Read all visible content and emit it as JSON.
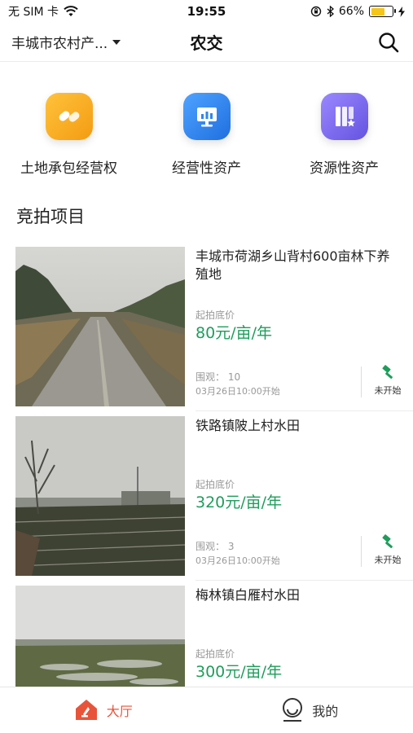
{
  "status_bar": {
    "carrier": "无 SIM 卡",
    "time": "19:55",
    "battery": "66%",
    "battery_level": 0.66
  },
  "nav": {
    "location": "丰城市农村产...",
    "title": "农交"
  },
  "categories": [
    {
      "label": "土地承包经营权",
      "icon": "handshake-icon",
      "color": "#f7a623"
    },
    {
      "label": "经营性资产",
      "icon": "monitor-chart-icon",
      "color": "#2f86f0"
    },
    {
      "label": "资源性资产",
      "icon": "book-star-icon",
      "color": "#7765e8"
    }
  ],
  "section": {
    "title": "竞拍项目"
  },
  "auction_items": [
    {
      "title": "丰城市荷湖乡山背村600亩林下养殖地",
      "price_label": "起拍底价",
      "price": "80元/亩/年",
      "views": "围观：  10",
      "start_time": "03月26日10:00开始",
      "status": "未开始",
      "photo": "rural-road"
    },
    {
      "title": "铁路镇陂上村水田",
      "price_label": "起拍底价",
      "price": "320元/亩/年",
      "views": "围观：  3",
      "start_time": "03月26日10:00开始",
      "status": "未开始",
      "photo": "paddy-field"
    },
    {
      "title": "梅林镇白雁村水田",
      "price_label": "起拍底价",
      "price": "300元/亩/年",
      "photo": "flooded-field"
    }
  ],
  "tab_bar": {
    "tabs": [
      {
        "label": "大厅",
        "icon": "home-icon",
        "active": true
      },
      {
        "label": "我的",
        "icon": "profile-icon",
        "active": false
      }
    ]
  },
  "colors": {
    "accent_green": "#1f9d5c",
    "active_tab": "#e8543a"
  }
}
